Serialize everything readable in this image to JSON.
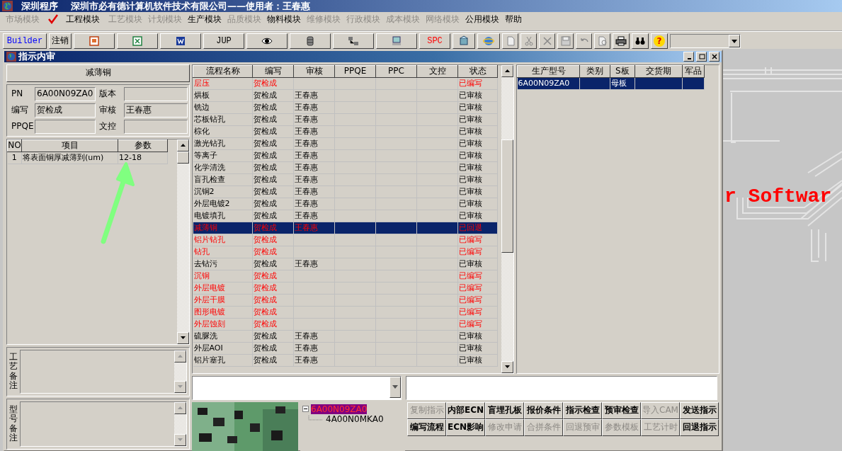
{
  "app_title": {
    "name": "深圳程序",
    "company": "深圳市必有德计算机软件技术有限公司——使用者：王春惠"
  },
  "menu": [
    {
      "label": "市场模块",
      "disabled": true,
      "checked": false
    },
    {
      "label": "工程模块",
      "disabled": false,
      "checked": true
    },
    {
      "label": "工艺模块",
      "disabled": true,
      "checked": false
    },
    {
      "label": "计划模块",
      "disabled": true,
      "checked": false
    },
    {
      "label": "生产模块",
      "disabled": false,
      "checked": false
    },
    {
      "label": "品质模块",
      "disabled": true,
      "checked": false
    },
    {
      "label": "物料模块",
      "disabled": false,
      "checked": false
    },
    {
      "label": "维修模块",
      "disabled": true,
      "checked": false
    },
    {
      "label": "行政模块",
      "disabled": true,
      "checked": false
    },
    {
      "label": "成本模块",
      "disabled": true,
      "checked": false
    },
    {
      "label": "网络模块",
      "disabled": true,
      "checked": false
    },
    {
      "label": "公用模块",
      "disabled": false,
      "checked": false
    },
    {
      "label": "帮助",
      "disabled": false,
      "checked": false
    }
  ],
  "toolbar": [
    {
      "kind": "text",
      "label": "Builder",
      "color": "#0000ff"
    },
    {
      "kind": "text",
      "label": "注销",
      "color": "#000000"
    },
    {
      "kind": "icon"
    },
    {
      "kind": "icon"
    },
    {
      "kind": "icon"
    },
    {
      "kind": "text",
      "label": "JUP",
      "color": "#000000"
    },
    {
      "kind": "icon"
    },
    {
      "kind": "icon"
    },
    {
      "kind": "icon"
    },
    {
      "kind": "icon"
    },
    {
      "kind": "text",
      "label": "SPC",
      "color": "#ff0000"
    },
    {
      "kind": "icon"
    },
    {
      "kind": "icon"
    },
    {
      "kind": "icon"
    },
    {
      "kind": "icon"
    },
    {
      "kind": "icon"
    },
    {
      "kind": "icon"
    },
    {
      "kind": "icon"
    },
    {
      "kind": "icon"
    },
    {
      "kind": "icon"
    },
    {
      "kind": "icon"
    },
    {
      "kind": "help",
      "label": "?"
    }
  ],
  "child_window": {
    "title": "指示内审"
  },
  "left_panel": {
    "header": "减薄铜",
    "fields": [
      {
        "label": "PN",
        "value": "6A00N09ZA0"
      },
      {
        "label": "版本"
      },
      {
        "label": "编写",
        "value": "贺检成"
      },
      {
        "label": "审核",
        "value": "王春惠"
      },
      {
        "label": "PPQE"
      },
      {
        "label": "文控"
      }
    ],
    "param_table": {
      "columns": [
        "NO",
        "项目",
        "参数"
      ],
      "rows": [
        [
          "1",
          "将表面铜厚减薄到(um)",
          "12-18"
        ]
      ]
    },
    "remarks": [
      {
        "label": "工艺备注"
      },
      {
        "label": "型号备注"
      }
    ]
  },
  "process_table": {
    "columns": [
      "流程名称",
      "编写",
      "审核",
      "PPQE",
      "PPC",
      "文控",
      "状态"
    ],
    "rows": [
      {
        "cells": [
          "层压",
          "贺检成",
          "",
          "",
          "",
          "",
          "已编写"
        ],
        "flagged": true,
        "selected": false
      },
      {
        "cells": [
          "烘板",
          "贺检成",
          "王春惠",
          "",
          "",
          "",
          "已审核"
        ],
        "flagged": false,
        "selected": false
      },
      {
        "cells": [
          "铣边",
          "贺检成",
          "王春惠",
          "",
          "",
          "",
          "已审核"
        ],
        "flagged": false,
        "selected": false
      },
      {
        "cells": [
          "芯板钻孔",
          "贺检成",
          "王春惠",
          "",
          "",
          "",
          "已审核"
        ],
        "flagged": false,
        "selected": false
      },
      {
        "cells": [
          "棕化",
          "贺检成",
          "王春惠",
          "",
          "",
          "",
          "已审核"
        ],
        "flagged": false,
        "selected": false
      },
      {
        "cells": [
          "激光钻孔",
          "贺检成",
          "王春惠",
          "",
          "",
          "",
          "已审核"
        ],
        "flagged": false,
        "selected": false
      },
      {
        "cells": [
          "等离子",
          "贺检成",
          "王春惠",
          "",
          "",
          "",
          "已审核"
        ],
        "flagged": false,
        "selected": false
      },
      {
        "cells": [
          "化学清洗",
          "贺检成",
          "王春惠",
          "",
          "",
          "",
          "已审核"
        ],
        "flagged": false,
        "selected": false
      },
      {
        "cells": [
          "盲孔检查",
          "贺检成",
          "王春惠",
          "",
          "",
          "",
          "已审核"
        ],
        "flagged": false,
        "selected": false
      },
      {
        "cells": [
          "沉铜2",
          "贺检成",
          "王春惠",
          "",
          "",
          "",
          "已审核"
        ],
        "flagged": false,
        "selected": false
      },
      {
        "cells": [
          "外层电镀2",
          "贺检成",
          "王春惠",
          "",
          "",
          "",
          "已审核"
        ],
        "flagged": false,
        "selected": false
      },
      {
        "cells": [
          "电镀填孔",
          "贺检成",
          "王春惠",
          "",
          "",
          "",
          "已审核"
        ],
        "flagged": false,
        "selected": false
      },
      {
        "cells": [
          "减薄铜",
          "贺检成",
          "王春惠",
          "",
          "",
          "",
          "已回退"
        ],
        "flagged": true,
        "selected": true
      },
      {
        "cells": [
          "铝片钻孔",
          "贺检成",
          "",
          "",
          "",
          "",
          "已编写"
        ],
        "flagged": true,
        "selected": false
      },
      {
        "cells": [
          "钻孔",
          "贺检成",
          "",
          "",
          "",
          "",
          "已编写"
        ],
        "flagged": true,
        "selected": false
      },
      {
        "cells": [
          "去钻污",
          "贺检成",
          "王春惠",
          "",
          "",
          "",
          "已审核"
        ],
        "flagged": false,
        "selected": false
      },
      {
        "cells": [
          "沉铜",
          "贺检成",
          "",
          "",
          "",
          "",
          "已编写"
        ],
        "flagged": true,
        "selected": false
      },
      {
        "cells": [
          "外层电镀",
          "贺检成",
          "",
          "",
          "",
          "",
          "已编写"
        ],
        "flagged": true,
        "selected": false
      },
      {
        "cells": [
          "外层干膜",
          "贺检成",
          "",
          "",
          "",
          "",
          "已编写"
        ],
        "flagged": true,
        "selected": false
      },
      {
        "cells": [
          "图形电镀",
          "贺检成",
          "",
          "",
          "",
          "",
          "已编写"
        ],
        "flagged": true,
        "selected": false
      },
      {
        "cells": [
          "外层蚀刻",
          "贺检成",
          "",
          "",
          "",
          "",
          "已编写"
        ],
        "flagged": true,
        "selected": false
      },
      {
        "cells": [
          "硫脲洗",
          "贺检成",
          "王春惠",
          "",
          "",
          "",
          "已审核"
        ],
        "flagged": false,
        "selected": false
      },
      {
        "cells": [
          "外层AOI",
          "贺检成",
          "王春惠",
          "",
          "",
          "",
          "已审核"
        ],
        "flagged": false,
        "selected": false
      },
      {
        "cells": [
          "铝片塞孔",
          "贺检成",
          "王春惠",
          "",
          "",
          "",
          "已审核"
        ],
        "flagged": false,
        "selected": false
      }
    ]
  },
  "model_table": {
    "columns": [
      "生产型号",
      "类别",
      "S板",
      "交货期",
      "军品"
    ],
    "rows": [
      {
        "cells": [
          "6A00N09ZA0",
          "",
          "母板",
          "",
          ""
        ],
        "selected": true
      }
    ]
  },
  "tree": [
    {
      "label": "6A00N09ZA0",
      "selected": true,
      "expanded": true,
      "children": [
        {
          "label": "4A00N0MKA0",
          "selected": false
        }
      ]
    }
  ],
  "action_buttons": [
    {
      "label": "复制指示",
      "disabled": true
    },
    {
      "label": "内部ECN",
      "disabled": false
    },
    {
      "label": "盲埋孔板",
      "disabled": false
    },
    {
      "label": "报价条件",
      "disabled": false
    },
    {
      "label": "指示检查",
      "disabled": false
    },
    {
      "label": "预审检查",
      "disabled": false
    },
    {
      "label": "导入CAM",
      "disabled": true
    },
    {
      "label": "发送指示",
      "disabled": false
    },
    {
      "label": "编写流程",
      "disabled": false
    },
    {
      "label": "ECN影响",
      "disabled": false
    },
    {
      "label": "修改申请",
      "disabled": true
    },
    {
      "label": "合拼条件",
      "disabled": true
    },
    {
      "label": "回退预审",
      "disabled": true
    },
    {
      "label": "参数模板",
      "disabled": true
    },
    {
      "label": "工艺计时",
      "disabled": true
    },
    {
      "label": "回退指示",
      "disabled": false
    }
  ],
  "background": {
    "caption": "r Softwar"
  }
}
